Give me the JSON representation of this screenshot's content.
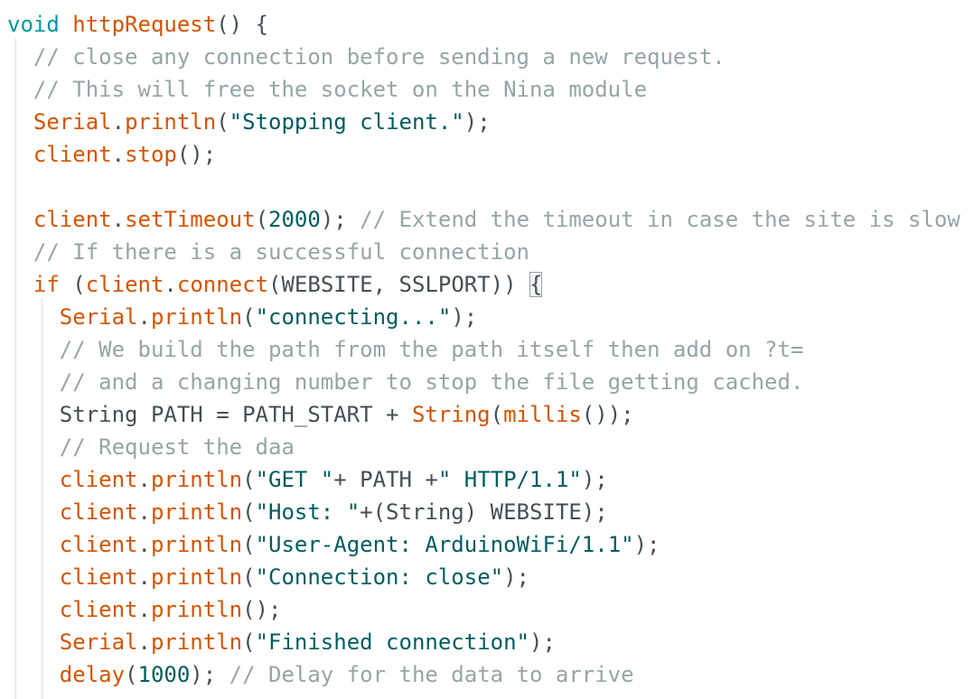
{
  "editor": {
    "lines": [
      {
        "indent": 0,
        "tokens": [
          {
            "t": "void",
            "c": "kw"
          },
          {
            "t": " ",
            "c": "id"
          },
          {
            "t": "httpRequest",
            "c": "fn"
          },
          {
            "t": "() {",
            "c": "id"
          }
        ]
      },
      {
        "indent": 1,
        "tokens": [
          {
            "t": "// close any connection before sending a new request.",
            "c": "cm"
          }
        ]
      },
      {
        "indent": 1,
        "tokens": [
          {
            "t": "// This will free the socket on the Nina module",
            "c": "cm"
          }
        ]
      },
      {
        "indent": 1,
        "tokens": [
          {
            "t": "Serial",
            "c": "obj"
          },
          {
            "t": ".",
            "c": "id"
          },
          {
            "t": "println",
            "c": "fn"
          },
          {
            "t": "(",
            "c": "id"
          },
          {
            "t": "\"Stopping client.\"",
            "c": "str"
          },
          {
            "t": ");",
            "c": "id"
          }
        ]
      },
      {
        "indent": 1,
        "tokens": [
          {
            "t": "client",
            "c": "obj"
          },
          {
            "t": ".",
            "c": "id"
          },
          {
            "t": "stop",
            "c": "fn"
          },
          {
            "t": "();",
            "c": "id"
          }
        ]
      },
      {
        "indent": 1,
        "tokens": []
      },
      {
        "indent": 1,
        "tokens": [
          {
            "t": "client",
            "c": "obj"
          },
          {
            "t": ".",
            "c": "id"
          },
          {
            "t": "setTimeout",
            "c": "fn"
          },
          {
            "t": "(",
            "c": "id"
          },
          {
            "t": "2000",
            "c": "num"
          },
          {
            "t": "); ",
            "c": "id"
          },
          {
            "t": "// Extend the timeout in case the site is slow",
            "c": "cm"
          }
        ]
      },
      {
        "indent": 1,
        "tokens": [
          {
            "t": "// If there is a successful connection",
            "c": "cm"
          }
        ]
      },
      {
        "indent": 1,
        "tokens": [
          {
            "t": "if",
            "c": "obj"
          },
          {
            "t": " (",
            "c": "id"
          },
          {
            "t": "client",
            "c": "obj"
          },
          {
            "t": ".",
            "c": "id"
          },
          {
            "t": "connect",
            "c": "fn"
          },
          {
            "t": "(WEBSITE, SSLPORT)) ",
            "c": "id"
          },
          {
            "t": "{",
            "c": "bm"
          }
        ]
      },
      {
        "indent": 2,
        "tokens": [
          {
            "t": "Serial",
            "c": "obj"
          },
          {
            "t": ".",
            "c": "id"
          },
          {
            "t": "println",
            "c": "fn"
          },
          {
            "t": "(",
            "c": "id"
          },
          {
            "t": "\"connecting...\"",
            "c": "str"
          },
          {
            "t": ");",
            "c": "id"
          }
        ]
      },
      {
        "indent": 2,
        "tokens": [
          {
            "t": "// We build the path from the path itself then add on ?t=",
            "c": "cm"
          }
        ]
      },
      {
        "indent": 2,
        "tokens": [
          {
            "t": "// and a changing number to stop the file getting cached.",
            "c": "cm"
          }
        ]
      },
      {
        "indent": 2,
        "tokens": [
          {
            "t": "String PATH = PATH_START + ",
            "c": "id"
          },
          {
            "t": "String",
            "c": "obj"
          },
          {
            "t": "(",
            "c": "id"
          },
          {
            "t": "millis",
            "c": "fn"
          },
          {
            "t": "());",
            "c": "id"
          }
        ]
      },
      {
        "indent": 2,
        "tokens": [
          {
            "t": "// Request the daa",
            "c": "cm"
          }
        ]
      },
      {
        "indent": 2,
        "tokens": [
          {
            "t": "client",
            "c": "obj"
          },
          {
            "t": ".",
            "c": "id"
          },
          {
            "t": "println",
            "c": "fn"
          },
          {
            "t": "(",
            "c": "id"
          },
          {
            "t": "\"GET \"",
            "c": "str"
          },
          {
            "t": "+ PATH +",
            "c": "id"
          },
          {
            "t": "\" HTTP/1.1\"",
            "c": "str"
          },
          {
            "t": ");",
            "c": "id"
          }
        ]
      },
      {
        "indent": 2,
        "tokens": [
          {
            "t": "client",
            "c": "obj"
          },
          {
            "t": ".",
            "c": "id"
          },
          {
            "t": "println",
            "c": "fn"
          },
          {
            "t": "(",
            "c": "id"
          },
          {
            "t": "\"Host: \"",
            "c": "str"
          },
          {
            "t": "+(String) WEBSITE);",
            "c": "id"
          }
        ]
      },
      {
        "indent": 2,
        "tokens": [
          {
            "t": "client",
            "c": "obj"
          },
          {
            "t": ".",
            "c": "id"
          },
          {
            "t": "println",
            "c": "fn"
          },
          {
            "t": "(",
            "c": "id"
          },
          {
            "t": "\"User-Agent: ArduinoWiFi/1.1\"",
            "c": "str"
          },
          {
            "t": ");",
            "c": "id"
          }
        ]
      },
      {
        "indent": 2,
        "tokens": [
          {
            "t": "client",
            "c": "obj"
          },
          {
            "t": ".",
            "c": "id"
          },
          {
            "t": "println",
            "c": "fn"
          },
          {
            "t": "(",
            "c": "id"
          },
          {
            "t": "\"Connection: close\"",
            "c": "str"
          },
          {
            "t": ");",
            "c": "id"
          }
        ]
      },
      {
        "indent": 2,
        "tokens": [
          {
            "t": "client",
            "c": "obj"
          },
          {
            "t": ".",
            "c": "id"
          },
          {
            "t": "println",
            "c": "fn"
          },
          {
            "t": "();",
            "c": "id"
          }
        ]
      },
      {
        "indent": 2,
        "tokens": [
          {
            "t": "Serial",
            "c": "obj"
          },
          {
            "t": ".",
            "c": "id"
          },
          {
            "t": "println",
            "c": "fn"
          },
          {
            "t": "(",
            "c": "id"
          },
          {
            "t": "\"Finished connection\"",
            "c": "str"
          },
          {
            "t": ");",
            "c": "id"
          }
        ]
      },
      {
        "indent": 2,
        "tokens": [
          {
            "t": "delay",
            "c": "fn"
          },
          {
            "t": "(",
            "c": "id"
          },
          {
            "t": "1000",
            "c": "num"
          },
          {
            "t": "); ",
            "c": "id"
          },
          {
            "t": "// Delay for the data to arrive",
            "c": "cm"
          }
        ]
      }
    ]
  },
  "colors": {
    "keyword": "#00979d",
    "function": "#d35400",
    "string": "#005c5f",
    "comment": "#95a5a6",
    "identifier": "#434f54",
    "indent_guide": "#dadfe0"
  }
}
